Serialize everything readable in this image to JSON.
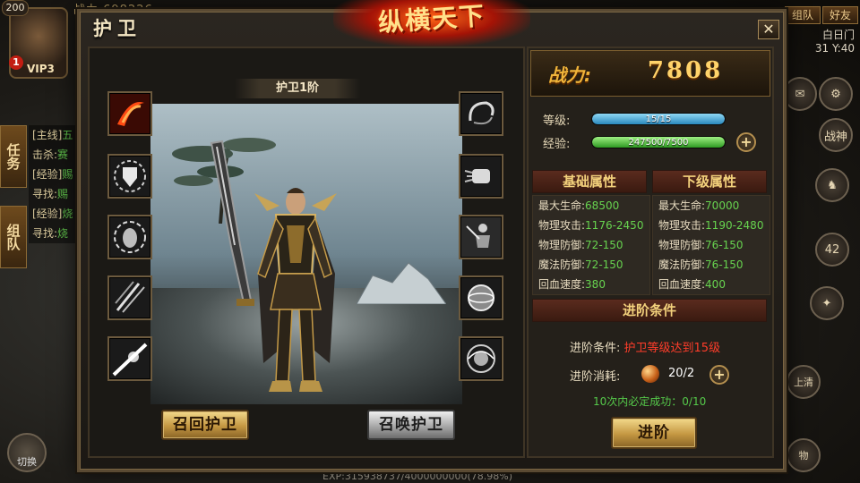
{
  "hud": {
    "level": "200",
    "alert": "1",
    "vip": "VIP3",
    "power_top": "战力 698226",
    "tab_task": "任务",
    "tab_team": "组队",
    "quests": [
      {
        "tag": "[主线]",
        "text": "五"
      },
      {
        "tag": "击杀:",
        "text": "赛"
      },
      {
        "tag": "[经验]",
        "text": "赐"
      },
      {
        "tag": "寻找:",
        "text": "赐"
      },
      {
        "tag": "[经验]",
        "text": "烧"
      },
      {
        "tag": "寻找:",
        "text": "烧"
      }
    ],
    "switch_label": "切换",
    "exp_text": "EXP:315938737/4000000000(78.98%)",
    "btn_group": "组队",
    "btn_friend": "好友",
    "map_name": "白日门",
    "coords": "31 Y:40",
    "war_god": "战神",
    "count_42": "42",
    "right_side_text": "上清",
    "item_text": "物"
  },
  "panel": {
    "title": "护卫",
    "logo": "纵横天下",
    "close": "✕",
    "tier_label": "护卫1阶",
    "recall_btn": "召回护卫",
    "summon_btn": "召唤护卫"
  },
  "skills_left": [
    {
      "icon": "fire-slash-icon"
    },
    {
      "icon": "shield-aura-icon"
    },
    {
      "icon": "egg-aura-icon"
    },
    {
      "icon": "claw-slash-icon"
    },
    {
      "icon": "light-beam-icon"
    }
  ],
  "skills_right": [
    {
      "icon": "whirl-icon"
    },
    {
      "icon": "fist-icon"
    },
    {
      "icon": "warrior-icon"
    },
    {
      "icon": "sphere-icon"
    },
    {
      "icon": "vortex-orb-icon"
    }
  ],
  "power": {
    "label": "战力:",
    "value": "7808"
  },
  "level": {
    "label": "等级:",
    "text": "15/15",
    "fraction": 1.0
  },
  "exp": {
    "label": "经验:",
    "text": "247500/7500",
    "fraction": 1.0
  },
  "base_attr": {
    "title": "基础属性",
    "rows": [
      {
        "k": "最大生命:",
        "v": "68500"
      },
      {
        "k": "物理攻击:",
        "v": "1176-2450"
      },
      {
        "k": "物理防御:",
        "v": "72-150"
      },
      {
        "k": "魔法防御:",
        "v": "72-150"
      },
      {
        "k": "回血速度:",
        "v": "380"
      }
    ]
  },
  "next_attr": {
    "title": "下级属性",
    "rows": [
      {
        "k": "最大生命:",
        "v": "70000"
      },
      {
        "k": "物理攻击:",
        "v": "1190-2480"
      },
      {
        "k": "物理防御:",
        "v": "76-150"
      },
      {
        "k": "魔法防御:",
        "v": "76-150"
      },
      {
        "k": "回血速度:",
        "v": "400"
      }
    ]
  },
  "advance": {
    "title": "进阶条件",
    "cond_label": "进阶条件:",
    "cond_value": "护卫等级达到15级",
    "cost_label": "进阶消耗:",
    "cost_value": "20/2",
    "guarantee": "10次内必定成功：0/10",
    "button": "进阶"
  },
  "colors": {
    "level_bar": "#3aa7d6",
    "exp_bar": "#3fb531",
    "gold": "#ffd36a",
    "green_value": "#67d34f",
    "red_value": "#ff3d2a"
  }
}
